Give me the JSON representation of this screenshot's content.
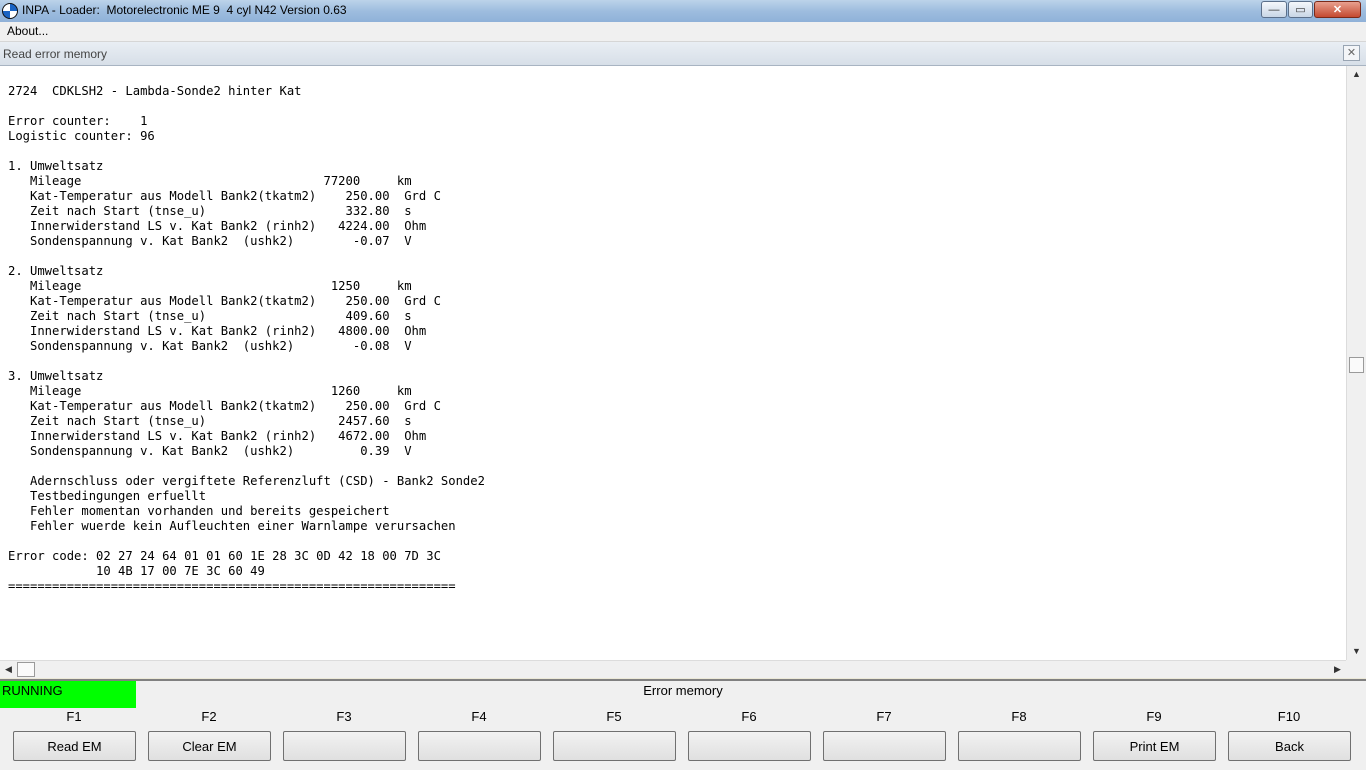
{
  "window": {
    "title": "INPA - Loader:  Motorelectronic ME 9  4 cyl N42 Version 0.63",
    "minimize": "—",
    "maximize": "▭",
    "close": "✕"
  },
  "menu": {
    "about": "About..."
  },
  "child_window": {
    "title": "Read error memory",
    "close": "✕"
  },
  "content_lines": [
    "2724  CDKLSH2 - Lambda-Sonde2 hinter Kat",
    "",
    "Error counter:    1",
    "Logistic counter: 96",
    "",
    "1. Umweltsatz",
    "   Mileage                                 77200     km",
    "   Kat-Temperatur aus Modell Bank2(tkatm2)    250.00  Grd C",
    "   Zeit nach Start (tnse_u)                   332.80  s",
    "   Innerwiderstand LS v. Kat Bank2 (rinh2)   4224.00  Ohm",
    "   Sondenspannung v. Kat Bank2  (ushk2)        -0.07  V",
    "",
    "2. Umweltsatz",
    "   Mileage                                  1250     km",
    "   Kat-Temperatur aus Modell Bank2(tkatm2)    250.00  Grd C",
    "   Zeit nach Start (tnse_u)                   409.60  s",
    "   Innerwiderstand LS v. Kat Bank2 (rinh2)   4800.00  Ohm",
    "   Sondenspannung v. Kat Bank2  (ushk2)        -0.08  V",
    "",
    "3. Umweltsatz",
    "   Mileage                                  1260     km",
    "   Kat-Temperatur aus Modell Bank2(tkatm2)    250.00  Grd C",
    "   Zeit nach Start (tnse_u)                  2457.60  s",
    "   Innerwiderstand LS v. Kat Bank2 (rinh2)   4672.00  Ohm",
    "   Sondenspannung v. Kat Bank2  (ushk2)         0.39  V",
    "",
    "   Adernschluss oder vergiftete Referenzluft (CSD) - Bank2 Sonde2",
    "   Testbedingungen erfuellt",
    "   Fehler momentan vorhanden und bereits gespeichert",
    "   Fehler wuerde kein Aufleuchten einer Warnlampe verursachen",
    "",
    "Error code: 02 27 24 64 01 01 60 1E 28 3C 0D 42 18 00 7D 3C",
    "            10 4B 17 00 7E 3C 60 49",
    "============================================================="
  ],
  "scroll": {
    "up": "▲",
    "down": "▼",
    "left": "◀",
    "right": "▶"
  },
  "status": {
    "state": "RUNNING",
    "mode_title": "Error memory"
  },
  "fkeys": [
    {
      "key": "F1",
      "label": "Read EM"
    },
    {
      "key": "F2",
      "label": "Clear EM"
    },
    {
      "key": "F3",
      "label": ""
    },
    {
      "key": "F4",
      "label": ""
    },
    {
      "key": "F5",
      "label": ""
    },
    {
      "key": "F6",
      "label": ""
    },
    {
      "key": "F7",
      "label": ""
    },
    {
      "key": "F8",
      "label": ""
    },
    {
      "key": "F9",
      "label": "Print EM"
    },
    {
      "key": "F10",
      "label": "Back"
    }
  ],
  "colors": {
    "status_running": "#00ff00"
  }
}
